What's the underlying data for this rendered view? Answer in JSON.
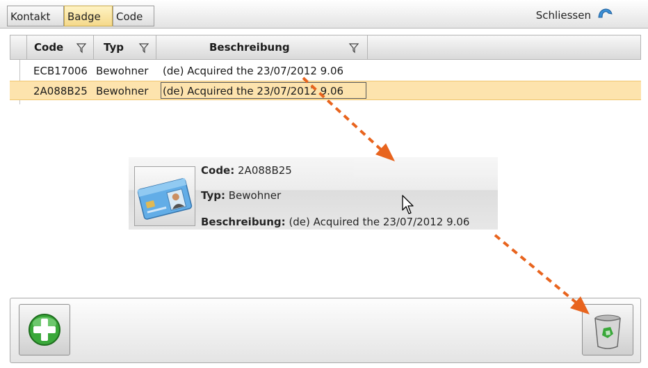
{
  "tabs": [
    {
      "label": "Kontakt",
      "active": false
    },
    {
      "label": "Badge",
      "active": true
    },
    {
      "label": "Code",
      "active": false
    }
  ],
  "close_label": "Schliessen",
  "grid": {
    "columns": [
      "Code",
      "Typ",
      "Beschreibung"
    ],
    "rows": [
      {
        "code": "ECB17006",
        "typ": "Bewohner",
        "beschreibung": "(de) Acquired the 23/07/2012 9.06",
        "selected": false
      },
      {
        "code": "2A088B25",
        "typ": "Bewohner",
        "beschreibung": "(de) Acquired the 23/07/2012 9.06",
        "selected": true
      }
    ]
  },
  "drag_preview": {
    "code_label": "Code:",
    "code_value": "2A088B25",
    "typ_label": "Typ:",
    "typ_value": "Bewohner",
    "beschreibung_label": "Beschreibung:",
    "beschreibung_value": "(de) Acquired the 23/07/2012 9.06",
    "icon": "id-card-icon"
  },
  "toolbar": {
    "add_icon": "plus-icon",
    "delete_icon": "trash-icon"
  },
  "colors": {
    "selected_row": "#fde3ad",
    "active_tab": "#f5d98a",
    "arrow": "#e8641e",
    "add_green": "#3aa83a"
  }
}
